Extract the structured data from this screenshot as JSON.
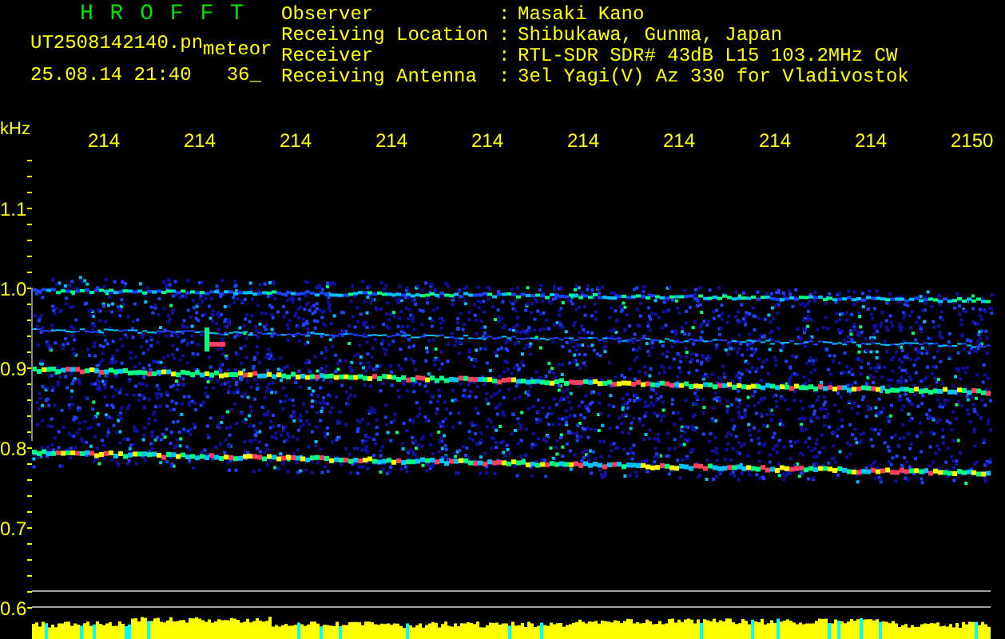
{
  "header": {
    "app_title": "H R O F F T",
    "file": "UT2508142140.pn",
    "tag": "meteor",
    "datetime": "25.08.14 21:40",
    "count": "36_"
  },
  "info": [
    {
      "label": "Observer",
      "colon": ":",
      "value": "Masaki Kano"
    },
    {
      "label": "Receiving Location",
      "colon": ":",
      "value": "Shibukawa, Gunma, Japan"
    },
    {
      "label": "Receiver",
      "colon": ":",
      "value": "RTL-SDR SDR# 43dB L15 103.2MHz CW"
    },
    {
      "label": "Receiving Antenna",
      "colon": ":",
      "value": "3el Yagi(V) Az 330 for Vladivostok"
    }
  ],
  "spectrogram": {
    "unit": "kHz",
    "x_ticks": [
      "214",
      "214",
      "214",
      "214",
      "214",
      "214",
      "214",
      "214",
      "214",
      "2150"
    ],
    "y_ticks": [
      "1.1",
      "1.0",
      "0.9",
      "0.8",
      "0.7",
      "0.6"
    ]
  }
}
